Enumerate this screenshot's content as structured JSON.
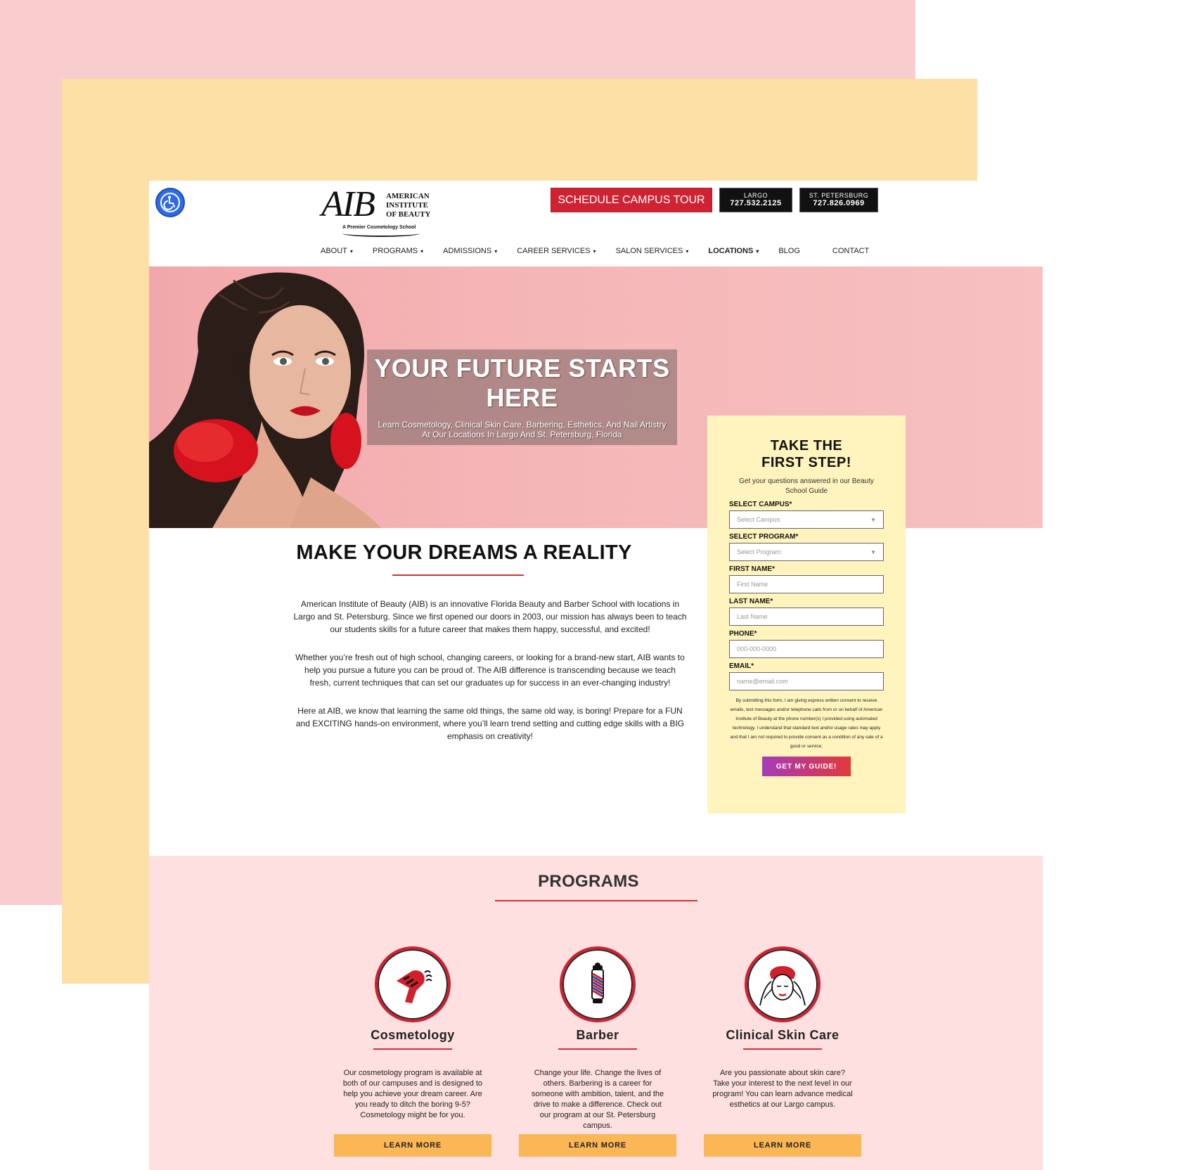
{
  "accessibility": {
    "label": "Accessibility"
  },
  "logo": {
    "main": "AIB",
    "line1": "American",
    "line2": "Institute",
    "line3": "Of Beauty",
    "tagline": "A Premier Cosmetology School"
  },
  "header": {
    "tour_label": "SCHEDULE CAMPUS TOUR",
    "phones": [
      {
        "city": "LARGO",
        "number": "727.532.2125"
      },
      {
        "city": "ST. PETERSBURG",
        "number": "727.826.0969"
      }
    ]
  },
  "nav": {
    "items": [
      {
        "label": "ABOUT",
        "caret": "▾"
      },
      {
        "label": "PROGRAMS",
        "caret": "▾"
      },
      {
        "label": "ADMISSIONS",
        "caret": "▾"
      },
      {
        "label": "CAREER SERVICES",
        "caret": "▾"
      },
      {
        "label": "SALON SERVICES",
        "caret": "▾"
      },
      {
        "label": "LOCATIONS",
        "caret": "▾"
      },
      {
        "label": "BLOG",
        "caret": ""
      },
      {
        "label": "CONTACT",
        "caret": ""
      }
    ]
  },
  "hero": {
    "title": "YOUR FUTURE STARTS HERE",
    "subtitle": "Learn Cosmetology, Clinical Skin Care, Barbering, Esthetics, And Nail Artistry At Our Locations In Largo And St. Petersburg, Florida"
  },
  "main": {
    "title": "MAKE YOUR DREAMS A REALITY",
    "paragraphs": [
      "American Institute of Beauty (AIB) is an innovative Florida Beauty and Barber School with locations in Largo and St. Petersburg. Since we first opened our doors in 2003, our mission has always been to teach our students skills for a future career that makes them happy, successful, and excited!",
      "Whether you’re fresh out of high school, changing careers, or looking for a brand-new start, AIB wants to help you pursue a future you can be proud of. The AIB difference is transcending because we teach fresh, current techniques that can set our graduates up for success in an ever-changing industry!",
      "Here at AIB, we know that learning the same old things, the same old way, is boring! Prepare for a FUN and EXCITING hands-on environment, where you’ll learn trend setting and cutting edge skills with a BIG emphasis on creativity!"
    ]
  },
  "form": {
    "title_line1": "TAKE THE",
    "title_line2": "FIRST STEP!",
    "subtitle": "Get your questions answered in our Beauty School Guide",
    "campus_label": "SELECT CAMPUS*",
    "campus_value": "Select Campus:",
    "program_label": "SELECT PROGRAM*",
    "program_value": "Select Program:",
    "first_label": "FIRST NAME*",
    "first_placeholder": "First Name",
    "last_label": "LAST NAME*",
    "last_placeholder": "Last Name",
    "phone_label": "PHONE*",
    "phone_placeholder": "000-000-0000",
    "email_label": "EMAIL*",
    "email_placeholder": "name@email.com",
    "consent": "By submitting this form, I am giving express written consent to receive emails, text messages and/or telephone calls from or on behalf of American Institute of Beauty at the phone number(s) I provided using automated technology. I understand that standard text and/or usage rates may apply and that I am not required to provide consent as a condition of any sale of a good or service.",
    "submit_label": "GET MY GUIDE!"
  },
  "programs": {
    "title": "PROGRAMS",
    "items": [
      {
        "name": "Cosmetology",
        "icon": "hair-dryer-icon",
        "desc": "Our cosmetology program is available at both of our campuses and is designed to help you achieve your dream career. Are you ready to ditch the boring 9-5? Cosmetology might be for you.",
        "button": "LEARN MORE"
      },
      {
        "name": "Barber",
        "icon": "barber-pole-icon",
        "desc": "Change your life. Change the lives of others. Barbering is a career for someone with ambition, talent, and the drive to make a difference. Check out our program at our St. Petersburg campus.",
        "button": "LEARN MORE"
      },
      {
        "name": "Clinical Skin Care",
        "icon": "facial-treatment-icon",
        "desc": "Are you passionate about skin care? Take your interest to the next level in our program! You can learn advance medical esthetics at our Largo campus.",
        "button": "LEARN MORE"
      }
    ]
  },
  "colors": {
    "accent_red": "#cf2232",
    "hero_pink": "#f5b5b6",
    "form_yellow": "#fff4bd",
    "programs_bg": "#fde0df",
    "button_orange": "#fbb655"
  }
}
